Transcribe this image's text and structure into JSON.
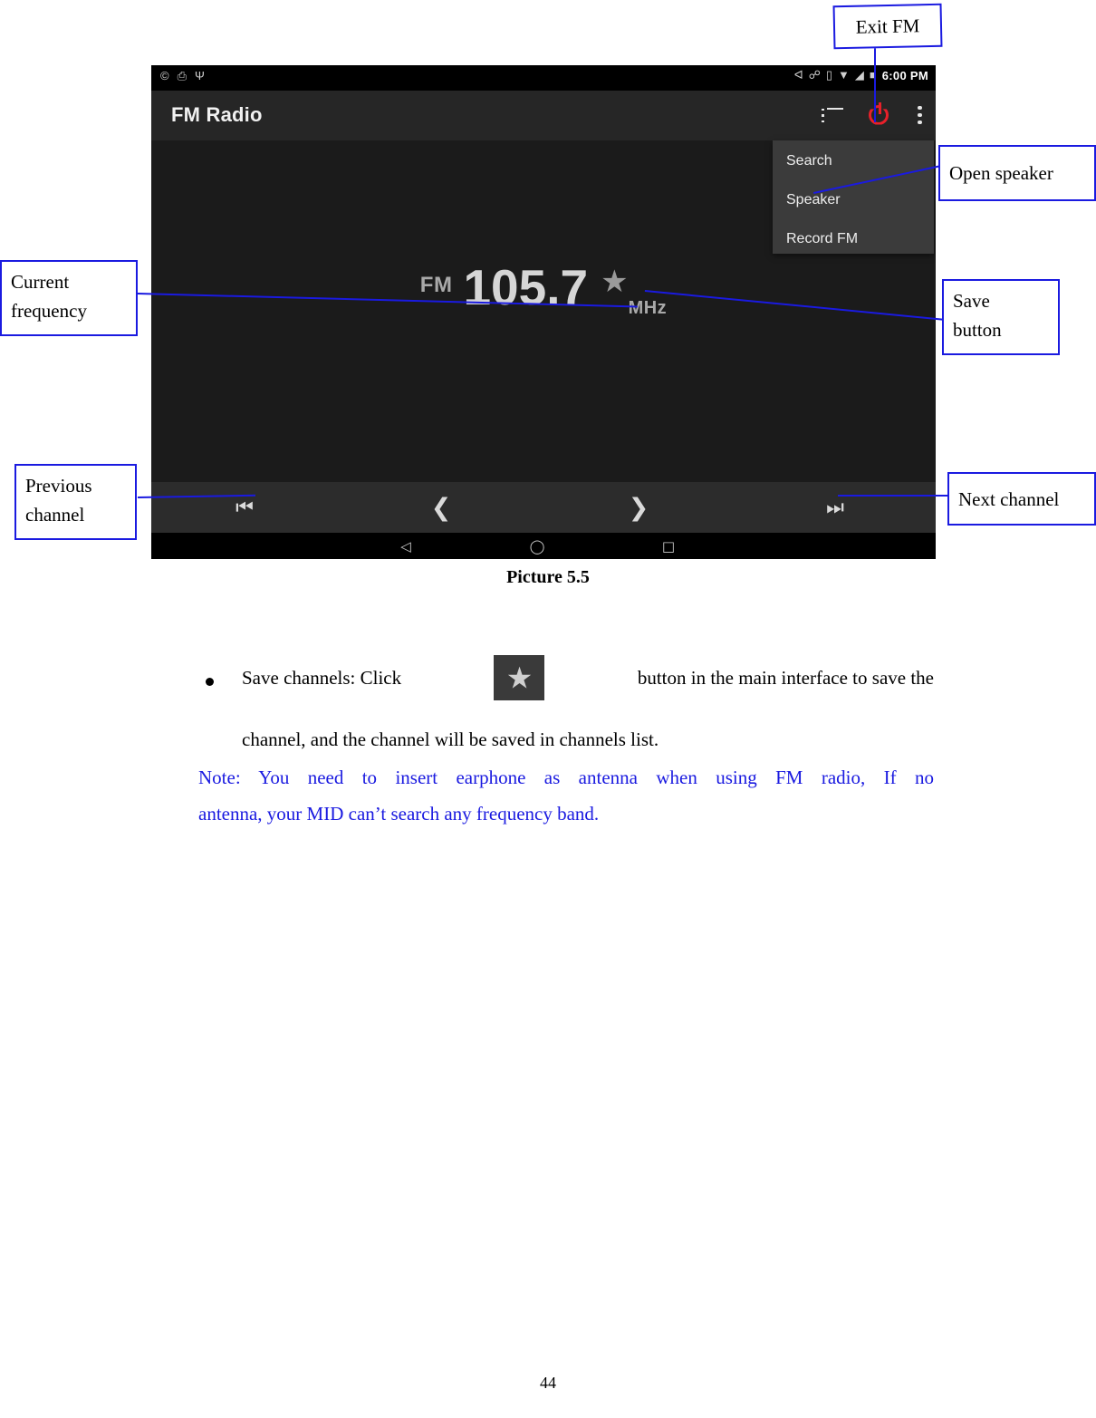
{
  "callouts": {
    "exit_fm": "Exit FM",
    "open_speaker": "Open speaker",
    "current_frequency": "Current\nfrequency",
    "current_frequency_l1": "Current",
    "current_frequency_l2": "frequency",
    "save_button_l1": "Save",
    "save_button_l2": "button",
    "previous_channel_l1": "Previous",
    "previous_channel_l2": "channel",
    "next_channel": "Next channel"
  },
  "device": {
    "status_bar": {
      "left_icons": [
        "copyright-icon",
        "screenshot-icon",
        "usb-icon"
      ],
      "right_icons": [
        "bluetooth-icon",
        "headset-icon",
        "sdcard-icon",
        "wifi-icon",
        "signal-icon",
        "battery-icon"
      ],
      "time": "6:00 PM"
    },
    "app_bar": {
      "title": "FM Radio",
      "icons": [
        "channel-list-icon",
        "power-icon",
        "overflow-menu-icon"
      ]
    },
    "overflow_menu": {
      "items": [
        "Search",
        "Speaker",
        "Record FM"
      ]
    },
    "radio": {
      "band_label": "FM",
      "frequency": "105.7",
      "unit_label": "MHz",
      "favorite_icon": "star-icon"
    },
    "transport": {
      "prev_channel": "prev-channel-icon",
      "prev_station": "chevron-left-icon",
      "next_station": "chevron-right-icon",
      "next_channel": "next-channel-icon"
    },
    "nav_bar": {
      "back": "back-triangle-icon",
      "home": "home-circle-icon",
      "recents": "recents-square-icon"
    }
  },
  "caption": "Picture 5.5",
  "body": {
    "bullet_part1": "Save  channels:  Click",
    "bullet_icon": "star-button-icon",
    "bullet_part2": "button   in   the   main   interface   to   save   the",
    "bullet_line2": "channel, and the channel will be saved in channels list.",
    "note_line1": "Note:  You  need  to  insert  earphone  as  antenna  when  using  FM  radio,  If  no",
    "note_line2": "antenna, your MID can’t search any frequency band."
  },
  "page_number": "44",
  "colors": {
    "callout_border": "#1a1ae0",
    "note_text": "#1a1ae0",
    "power_icon": "#e8202a",
    "device_bg": "#1b1b1b"
  }
}
